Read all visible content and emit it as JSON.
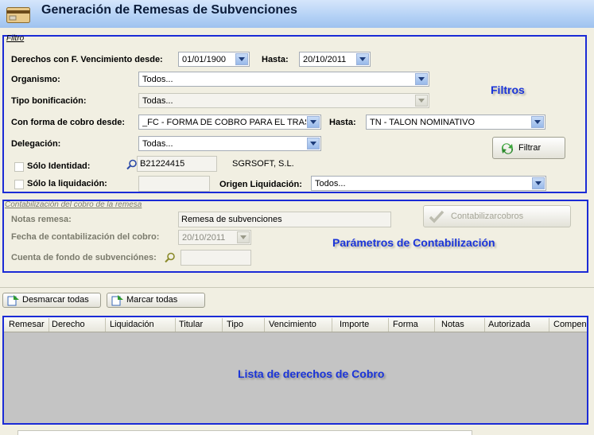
{
  "window": {
    "title": "Generación de Remesas de Subvenciones",
    "icon": "card-icon"
  },
  "filtro": {
    "legend": "Filtro",
    "derechos_label": "Derechos con F. Vencimiento desde:",
    "desde_value": "01/01/1900",
    "hasta_label": "Hasta:",
    "hasta_value": "20/10/2011",
    "organismo_label": "Organismo:",
    "organismo_value": "Todos...",
    "tipo_label": "Tipo bonificación:",
    "tipo_value": "Todas...",
    "forma_label": "Con forma de cobro desde:",
    "forma_desde_value": "_FC - FORMA DE COBRO PARA EL TRASI",
    "forma_hasta_label": "Hasta:",
    "forma_hasta_value": "TN - TALON NOMINATIVO",
    "delegacion_label": "Delegación:",
    "delegacion_value": "Todas...",
    "solo_identidad_label": "Sólo Identidad:",
    "identidad_value": "B21224415",
    "identidad_name": "SGRSOFT, S.L.",
    "solo_liquidacion_label": "Sólo  la liquidación:",
    "origen_label": "Origen Liquidación:",
    "origen_value": "Todos...",
    "filtrar_label": "Filtrar",
    "callout": "Filtros"
  },
  "contabilizacion": {
    "legend": "Contabilización del cobro de la remesa",
    "notas_label": "Notas remesa:",
    "notas_value": "Remesa de subvenciones",
    "fecha_label": "Fecha de contabilización del cobro:",
    "fecha_value": "20/10/2011",
    "cuenta_label": "Cuenta de fondo de subvenciónes:",
    "contabilizar_label": "Contabilizarcobros",
    "callout": "Parámetros de Contabilización"
  },
  "toolbar": {
    "desmarcar_label": "Desmarcar todas",
    "marcar_label": "Marcar todas"
  },
  "grid": {
    "columns": [
      "Remesar",
      "Derecho",
      "Liquidación",
      "Titular",
      "Tipo",
      "Vencimiento",
      "Importe",
      "Forma",
      "Notas",
      "Autorizada",
      "Compen"
    ],
    "callout": "Lista de derechos de Cobro"
  }
}
